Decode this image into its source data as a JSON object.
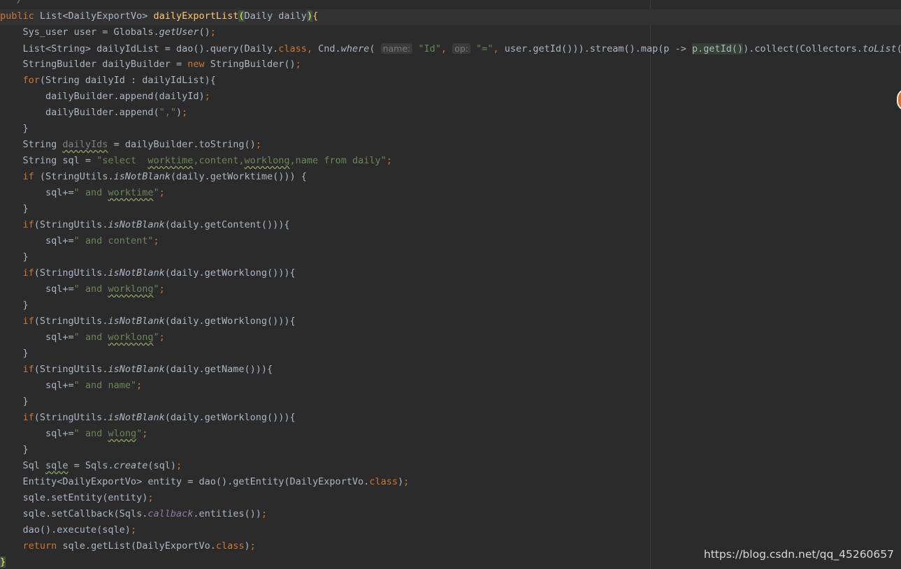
{
  "code_lines": [
    [
      {
        "t": " **/",
        "c": "cmt"
      }
    ],
    [
      {
        "t": "public",
        "c": "kw"
      },
      {
        "t": " List<DailyExportVo> "
      },
      {
        "t": "dailyExportList",
        "c": "fn"
      },
      {
        "t": "(",
        "c": "brace-hl"
      },
      {
        "t": "Daily daily"
      },
      {
        "t": ")",
        "c": "brace-hl"
      },
      {
        "t": "{",
        "c": "fn"
      }
    ],
    [
      {
        "t": "    Sys_user user = Globals."
      },
      {
        "t": "getUser",
        "c": "it"
      },
      {
        "t": "()"
      },
      {
        "t": ";",
        "c": "kw"
      }
    ],
    [
      {
        "t": "    List<String> dailyIdList = dao().query(Daily."
      },
      {
        "t": "class",
        "c": "kw"
      },
      {
        "t": ", ",
        "c": "kw"
      },
      {
        "t": "Cnd."
      },
      {
        "t": "where",
        "c": "it"
      },
      {
        "t": "( "
      },
      {
        "t": "name:",
        "c": "hint"
      },
      {
        "t": " "
      },
      {
        "t": "\"Id\"",
        "c": "str"
      },
      {
        "t": ", ",
        "c": "kw"
      },
      {
        "t": "op:",
        "c": "hint"
      },
      {
        "t": " "
      },
      {
        "t": "\"=\"",
        "c": "str"
      },
      {
        "t": ", ",
        "c": "kw"
      },
      {
        "t": "user.getId())).stream().map(p -> "
      },
      {
        "t": "p.getId()",
        "c": "usage"
      },
      {
        "t": ").collect(Collectors."
      },
      {
        "t": "toList",
        "c": "it"
      },
      {
        "t": "())"
      },
      {
        "t": ";",
        "c": "kw"
      }
    ],
    [
      {
        "t": "    StringBuilder dailyBuilder = "
      },
      {
        "t": "new",
        "c": "kw"
      },
      {
        "t": " StringBuilder()"
      },
      {
        "t": ";",
        "c": "kw"
      }
    ],
    [
      {
        "t": "    "
      },
      {
        "t": "for",
        "c": "kw"
      },
      {
        "t": "(String dailyId : dailyIdList){"
      }
    ],
    [
      {
        "t": "        dailyBuilder.append(dailyId)"
      },
      {
        "t": ";",
        "c": "kw"
      }
    ],
    [
      {
        "t": "        dailyBuilder.append("
      },
      {
        "t": "\",\"",
        "c": "str"
      },
      {
        "t": ")"
      },
      {
        "t": ";",
        "c": "kw"
      }
    ],
    [
      {
        "t": "    }"
      }
    ],
    [
      {
        "t": "    String "
      },
      {
        "t": "dailyIds",
        "c": "gray squig"
      },
      {
        "t": " = dailyBuilder.toString()"
      },
      {
        "t": ";",
        "c": "kw"
      }
    ],
    [
      {
        "t": "    String sql = "
      },
      {
        "t": "\"select  ",
        "c": "str"
      },
      {
        "t": "worktime",
        "c": "str squig"
      },
      {
        "t": ",content,",
        "c": "str"
      },
      {
        "t": "worklong",
        "c": "str squig"
      },
      {
        "t": ",name from daily\"",
        "c": "str"
      },
      {
        "t": ";",
        "c": "kw"
      }
    ],
    [
      {
        "t": "    "
      },
      {
        "t": "if",
        "c": "kw"
      },
      {
        "t": " (StringUtils."
      },
      {
        "t": "isNotBlank",
        "c": "it"
      },
      {
        "t": "(daily.getWorktime())) {"
      }
    ],
    [
      {
        "t": "        sql+="
      },
      {
        "t": "\" and ",
        "c": "str"
      },
      {
        "t": "worktime",
        "c": "str squig"
      },
      {
        "t": "\"",
        "c": "str"
      },
      {
        "t": ";",
        "c": "kw"
      }
    ],
    [
      {
        "t": "    }"
      }
    ],
    [
      {
        "t": "    "
      },
      {
        "t": "if",
        "c": "kw"
      },
      {
        "t": "(StringUtils."
      },
      {
        "t": "isNotBlank",
        "c": "it"
      },
      {
        "t": "(daily.getContent())){"
      }
    ],
    [
      {
        "t": "        sql+="
      },
      {
        "t": "\" and content\"",
        "c": "str"
      },
      {
        "t": ";",
        "c": "kw"
      }
    ],
    [
      {
        "t": "    }"
      }
    ],
    [
      {
        "t": "    "
      },
      {
        "t": "if",
        "c": "kw"
      },
      {
        "t": "(StringUtils."
      },
      {
        "t": "isNotBlank",
        "c": "it"
      },
      {
        "t": "(daily.getWorklong())){"
      }
    ],
    [
      {
        "t": "        sql+="
      },
      {
        "t": "\" and ",
        "c": "str"
      },
      {
        "t": "worklong",
        "c": "str squig"
      },
      {
        "t": "\"",
        "c": "str"
      },
      {
        "t": ";",
        "c": "kw"
      }
    ],
    [
      {
        "t": "    }"
      }
    ],
    [
      {
        "t": "    "
      },
      {
        "t": "if",
        "c": "kw"
      },
      {
        "t": "(StringUtils."
      },
      {
        "t": "isNotBlank",
        "c": "it"
      },
      {
        "t": "(daily.getWorklong())){"
      }
    ],
    [
      {
        "t": "        sql+="
      },
      {
        "t": "\" and ",
        "c": "str"
      },
      {
        "t": "worklong",
        "c": "str squig"
      },
      {
        "t": "\"",
        "c": "str"
      },
      {
        "t": ";",
        "c": "kw"
      }
    ],
    [
      {
        "t": "    }"
      }
    ],
    [
      {
        "t": "    "
      },
      {
        "t": "if",
        "c": "kw"
      },
      {
        "t": "(StringUtils."
      },
      {
        "t": "isNotBlank",
        "c": "it"
      },
      {
        "t": "(daily.getName())){"
      }
    ],
    [
      {
        "t": "        sql+="
      },
      {
        "t": "\" and name\"",
        "c": "str"
      },
      {
        "t": ";",
        "c": "kw"
      }
    ],
    [
      {
        "t": "    }"
      }
    ],
    [
      {
        "t": "    "
      },
      {
        "t": "if",
        "c": "kw"
      },
      {
        "t": "(StringUtils."
      },
      {
        "t": "isNotBlank",
        "c": "it"
      },
      {
        "t": "(daily.getWorklong())){"
      }
    ],
    [
      {
        "t": "        sql+="
      },
      {
        "t": "\" and ",
        "c": "str"
      },
      {
        "t": "wlong",
        "c": "str squig"
      },
      {
        "t": "\"",
        "c": "str"
      },
      {
        "t": ";",
        "c": "kw"
      }
    ],
    [
      {
        "t": "    }"
      }
    ],
    [
      {
        "t": "    Sql "
      },
      {
        "t": "sqle",
        "c": "squig"
      },
      {
        "t": " = Sqls."
      },
      {
        "t": "create",
        "c": "it"
      },
      {
        "t": "(sql)"
      },
      {
        "t": ";",
        "c": "kw"
      }
    ],
    [
      {
        "t": "    Entity<DailyExportVo> entity = dao().getEntity(DailyExportVo."
      },
      {
        "t": "class",
        "c": "kw"
      },
      {
        "t": ")"
      },
      {
        "t": ";",
        "c": "kw"
      }
    ],
    [
      {
        "t": "    sqle.setEntity(entity)"
      },
      {
        "t": ";",
        "c": "kw"
      }
    ],
    [
      {
        "t": "    sqle.setCallback(Sqls."
      },
      {
        "t": "callback",
        "c": "sfield"
      },
      {
        "t": ".entities())"
      },
      {
        "t": ";",
        "c": "kw"
      }
    ],
    [
      {
        "t": "    dao().execute(sqle)"
      },
      {
        "t": ";",
        "c": "kw"
      }
    ],
    [
      {
        "t": "    "
      },
      {
        "t": "return",
        "c": "kw"
      },
      {
        "t": " sqle.getList(DailyExportVo."
      },
      {
        "t": "class",
        "c": "kw"
      },
      {
        "t": ")"
      },
      {
        "t": ";",
        "c": "kw"
      }
    ],
    [
      {
        "t": "}",
        "c": "brace-hl"
      }
    ]
  ],
  "watermark": "https://blog.csdn.net/qq_45260657",
  "colors": {
    "background": "#2b2b2b",
    "text": "#a9b7c6",
    "keyword": "#cc7832",
    "method_declaration": "#ffc66d",
    "string": "#6a8759",
    "static_field": "#9876aa",
    "comment": "#629755"
  }
}
